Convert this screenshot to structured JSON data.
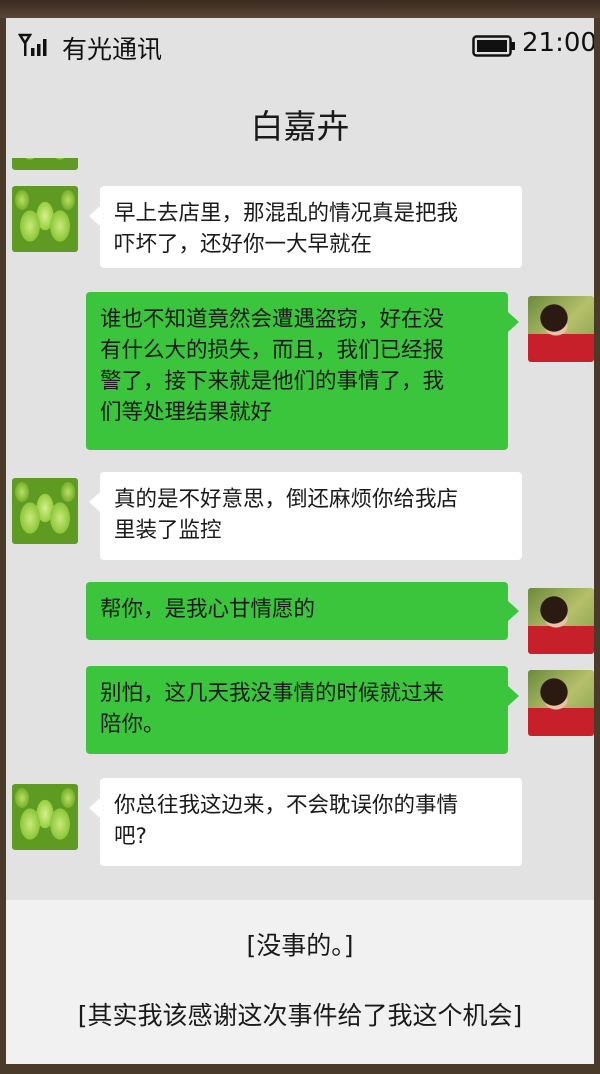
{
  "status_bar": {
    "carrier": "有光通讯",
    "time": "21:00",
    "signal_icon": "signal-icon",
    "battery_icon": "battery-icon"
  },
  "chat": {
    "title": "白嘉卉",
    "messages": [
      {
        "side": "left",
        "avatar": "succulent-avatar",
        "lines": [
          "早上去店里，那混乱的情况真是把我",
          "吓坏了，还好你一大早就在"
        ]
      },
      {
        "side": "right",
        "avatar": "girl-avatar",
        "lines": [
          "谁也不知道竟然会遭遇盗窃，好在没",
          "有什么大的损失，而且，我们已经报",
          "警了，接下来就是他们的事情了，我",
          "们等处理结果就好"
        ]
      },
      {
        "side": "left",
        "avatar": "succulent-avatar",
        "lines": [
          "真的是不好意思，倒还麻烦你给我店",
          "里装了监控"
        ]
      },
      {
        "side": "right",
        "avatar": "girl-avatar",
        "lines": [
          "帮你，是我心甘情愿的"
        ]
      },
      {
        "side": "right",
        "avatar": "girl-avatar",
        "lines": [
          "别怕，这几天我没事情的时候就过来",
          "陪你。"
        ]
      },
      {
        "side": "left",
        "avatar": "succulent-avatar",
        "lines": [
          "你总往我这边来，不会耽误你的事情",
          "吧?"
        ]
      }
    ]
  },
  "choices": [
    {
      "label": "[没事的。]"
    },
    {
      "label": "[其实我该感谢这次事件给了我这个机会]"
    }
  ],
  "colors": {
    "incoming_bubble": "#ffffff",
    "outgoing_bubble": "#3bc53c",
    "background": "#e2e2e2"
  }
}
